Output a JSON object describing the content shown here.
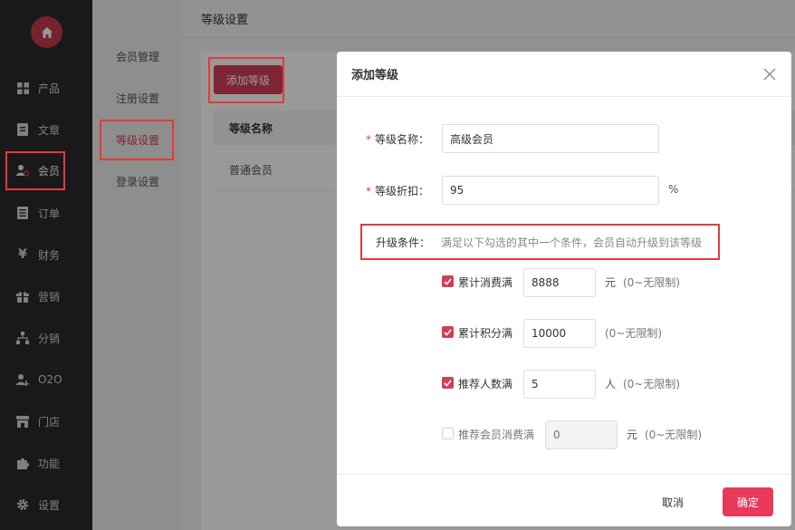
{
  "sidebar": {
    "items": [
      {
        "label": "产品",
        "icon": "grid-icon"
      },
      {
        "label": "文章",
        "icon": "document-icon"
      },
      {
        "label": "会员",
        "icon": "user-settings-icon"
      },
      {
        "label": "订单",
        "icon": "list-icon"
      },
      {
        "label": "财务",
        "icon": "yen-icon"
      },
      {
        "label": "营销",
        "icon": "gift-icon"
      },
      {
        "label": "分销",
        "icon": "network-icon"
      },
      {
        "label": "O2O",
        "icon": "user-key-icon"
      },
      {
        "label": "门店",
        "icon": "store-icon"
      },
      {
        "label": "功能",
        "icon": "puzzle-icon"
      },
      {
        "label": "设置",
        "icon": "gear-icon"
      }
    ]
  },
  "submenu": {
    "items": [
      {
        "label": "会员管理"
      },
      {
        "label": "注册设置"
      },
      {
        "label": "等级设置"
      },
      {
        "label": "登录设置"
      }
    ]
  },
  "main": {
    "title": "等级设置",
    "add_button": "添加等级",
    "table": {
      "header": "等级名称",
      "rows": [
        {
          "name": "普通会员"
        }
      ]
    }
  },
  "dialog": {
    "title": "添加等级",
    "name_label": "等级名称：",
    "name_value": "高级会员",
    "discount_label": "等级折扣：",
    "discount_value": "95",
    "discount_unit": "%",
    "condition_label": "升级条件：",
    "condition_hint": "满足以下勾选的其中一个条件，会员自动升级到该等级",
    "conditions": [
      {
        "label": "累计消费满",
        "value": "8888",
        "unit": "元",
        "note": "(0~无限制)",
        "checked": true
      },
      {
        "label": "累计积分满",
        "value": "10000",
        "unit": "",
        "note": "(0~无限制)",
        "checked": true
      },
      {
        "label": "推荐人数满",
        "value": "5",
        "unit": "人",
        "note": "(0~无限制)",
        "checked": true
      },
      {
        "label": "推荐会员消费满",
        "placeholder": "0",
        "unit": "元",
        "note": "(0~无限制)",
        "checked": false
      }
    ],
    "cancel": "取消",
    "confirm": "确定"
  },
  "colors": {
    "brand": "#d23f57",
    "sidebar_bg": "#2a2b2f",
    "highlight": "#e33b3b"
  }
}
